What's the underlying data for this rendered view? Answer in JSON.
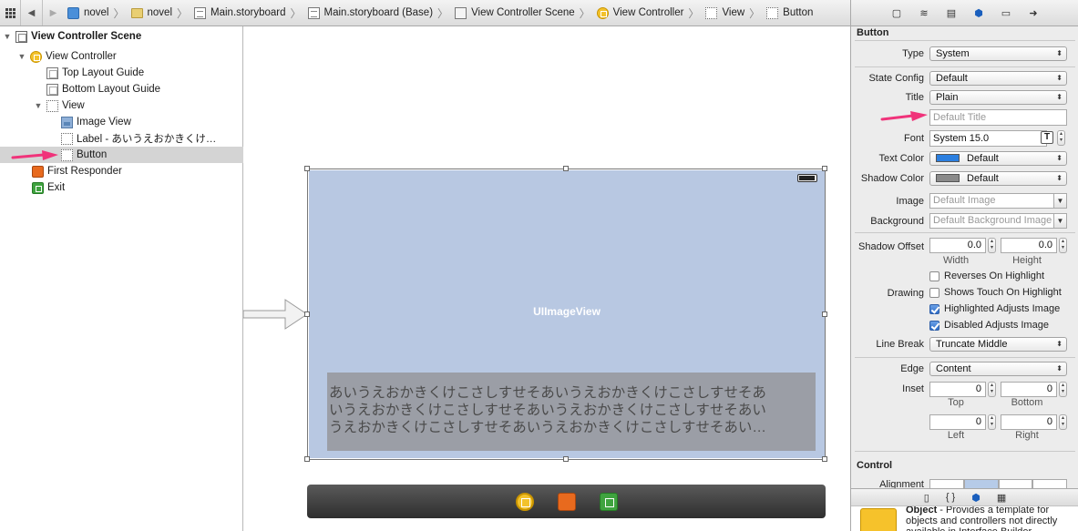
{
  "jumpbar": {
    "crumbs": [
      {
        "label": "novel",
        "icon": "project-icon"
      },
      {
        "label": "novel",
        "icon": "folder-icon"
      },
      {
        "label": "Main.storyboard",
        "icon": "storyboard-file-icon"
      },
      {
        "label": "Main.storyboard (Base)",
        "icon": "storyboard-file-icon"
      },
      {
        "label": "View Controller Scene",
        "icon": "scene-icon"
      },
      {
        "label": "View Controller",
        "icon": "view-controller-icon"
      },
      {
        "label": "View",
        "icon": "view-icon"
      },
      {
        "label": "Button",
        "icon": "button-icon"
      }
    ]
  },
  "outline": {
    "items": [
      {
        "label": "View Controller Scene"
      },
      {
        "label": "View Controller"
      },
      {
        "label": "Top Layout Guide"
      },
      {
        "label": "Bottom Layout Guide"
      },
      {
        "label": "View"
      },
      {
        "label": "Image View"
      },
      {
        "label": "Label - あいうえおかきくけ…"
      },
      {
        "label": "Button"
      },
      {
        "label": "First Responder"
      },
      {
        "label": "Exit"
      }
    ],
    "selected_index": 7
  },
  "canvas": {
    "image_view_label": "UIImageView",
    "label_lines": [
      "あいうえおかきくけこさしすせそあいうえおかきくけこさしすせそあ",
      "いうえおかきくけこさしすせそあいうえおかきくけこさしすせそあい",
      "うえおかきくけこさしすせそあいうえおかきくけこさしすせそあい…"
    ]
  },
  "inspector": {
    "section_title": "Button",
    "fields": {
      "type_label": "Type",
      "type_value": "System",
      "state_config_label": "State Config",
      "state_config_value": "Default",
      "title_label": "Title",
      "title_value": "Plain",
      "title_placeholder": "Default Title",
      "font_label": "Font",
      "font_value": "System 15.0",
      "text_color_label": "Text Color",
      "text_color_value": "Default",
      "text_color_swatch": "#2b7fe0",
      "shadow_color_label": "Shadow Color",
      "shadow_color_value": "Default",
      "shadow_color_swatch": "#8a8a8a",
      "image_label": "Image",
      "image_placeholder": "Default Image",
      "background_label": "Background",
      "background_placeholder": "Default Background Image",
      "shadow_offset_label": "Shadow Offset",
      "shadow_offset_width": "0.0",
      "shadow_offset_height": "0.0",
      "width_label": "Width",
      "height_label": "Height",
      "drawing_label": "Drawing",
      "reverses_on_highlight": "Reverses On Highlight",
      "shows_touch_on_highlight": "Shows Touch On Highlight",
      "highlighted_adjusts_image": "Highlighted Adjusts Image",
      "disabled_adjusts_image": "Disabled Adjusts Image",
      "line_break_label": "Line Break",
      "line_break_value": "Truncate Middle",
      "edge_label": "Edge",
      "edge_value": "Content",
      "inset_label": "Inset",
      "inset_top": "0",
      "inset_bottom": "0",
      "inset_left": "0",
      "inset_right": "0",
      "top_label": "Top",
      "bottom_label": "Bottom",
      "left_label": "Left",
      "right_label": "Right"
    },
    "checkboxes": {
      "reverses_on_highlight": false,
      "shows_touch_on_highlight": false,
      "highlighted_adjusts_image": true,
      "disabled_adjusts_image": true
    },
    "control_section_title": "Control",
    "alignment_label": "Alignment"
  },
  "library": {
    "tabs": [
      "file-template-icon",
      "code-snippet-icon",
      "object-library-icon",
      "media-library-icon"
    ],
    "item_title": "Object",
    "item_desc": " - Provides a template for objects and controllers not directly available in Interface Builder."
  }
}
